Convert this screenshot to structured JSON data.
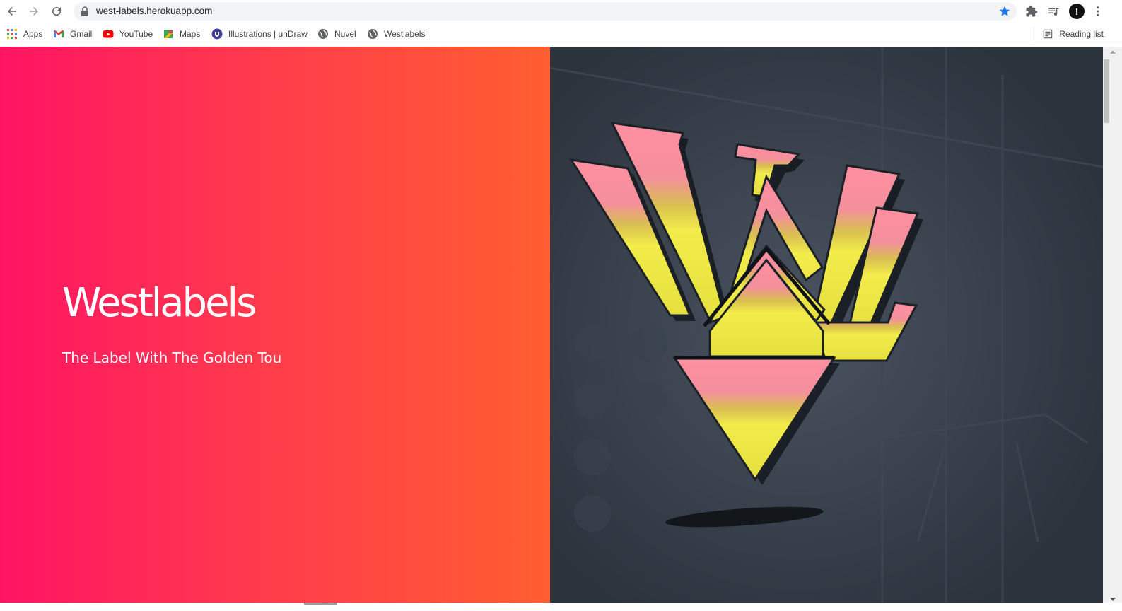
{
  "browser": {
    "url": "west-labels.herokuapp.com",
    "avatar_initial": "!",
    "icons": {
      "back": "arrow-left-icon",
      "forward": "arrow-right-icon",
      "reload": "reload-icon",
      "lock": "lock-icon",
      "bookmark": "star-icon",
      "extensions": "puzzle-icon",
      "media": "media-queue-icon",
      "menu": "kebab-menu-icon"
    },
    "accent_color": "#1a73e8"
  },
  "bookmarks": {
    "items": [
      {
        "label": "Apps",
        "icon": "apps-grid-icon"
      },
      {
        "label": "Gmail",
        "icon": "gmail-icon"
      },
      {
        "label": "YouTube",
        "icon": "youtube-icon"
      },
      {
        "label": "Maps",
        "icon": "maps-icon"
      },
      {
        "label": "Illustrations | unDraw",
        "icon": "undraw-icon"
      },
      {
        "label": "Nuvel",
        "icon": "globe-icon"
      },
      {
        "label": "Westlabels",
        "icon": "globe-icon"
      }
    ],
    "reading_list": "Reading list"
  },
  "hero": {
    "title": "Westlabels",
    "subtitle": "The Label With The Golden Tou",
    "gradient": [
      "#ff1463",
      "#ff5e30"
    ],
    "logo_colors": {
      "top": "#ff8fa0",
      "bottom": "#f7ee4a",
      "backdrop": "#323b46"
    }
  }
}
